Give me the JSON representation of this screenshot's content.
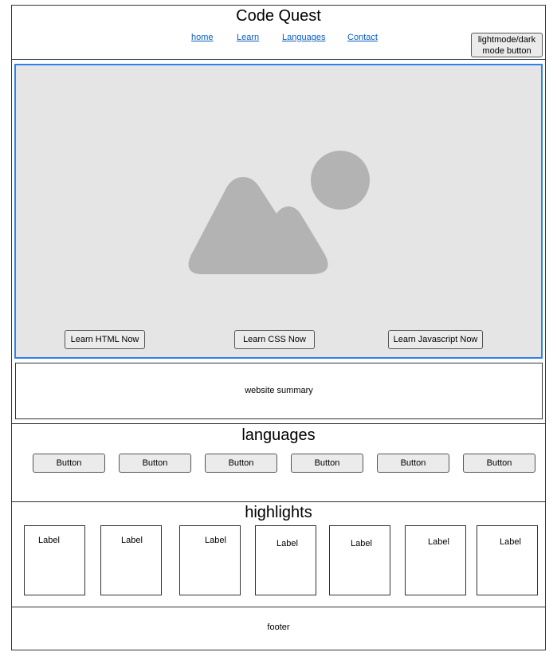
{
  "header": {
    "title": "Code Quest",
    "nav": [
      "home",
      "Learn",
      "Languages",
      "Contact"
    ],
    "theme_toggle_label": "lightmode/dark mode button"
  },
  "hero": {
    "buttons": [
      "Learn HTML Now",
      "Learn CSS Now",
      "Learn Javascript Now"
    ],
    "image_icon": "image-placeholder-icon"
  },
  "summary": {
    "text": "website summary"
  },
  "languages": {
    "title": "languages",
    "buttons": [
      "Button",
      "Button",
      "Button",
      "Button",
      "Button",
      "Button"
    ]
  },
  "highlights": {
    "title": "highlights",
    "cards": [
      "Label",
      "Label",
      "Label",
      "Label",
      "Label",
      "Label",
      "Label"
    ]
  },
  "footer": {
    "text": "footer"
  },
  "colors": {
    "accent_border": "#2f80ed",
    "link": "#0a5dc2",
    "hero_bg": "#e5e5e5",
    "button_bg": "#ebebeb"
  }
}
